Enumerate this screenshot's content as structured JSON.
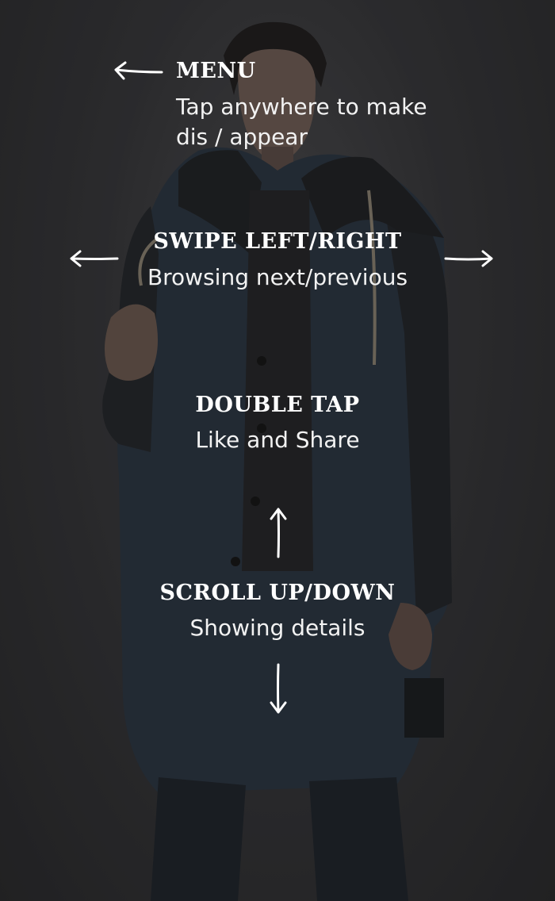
{
  "menu": {
    "title": "MENU",
    "description_line1": "Tap anywhere to make",
    "description_line2": "dis / appear"
  },
  "swipe": {
    "title": "SWIPE LEFT/RIGHT",
    "description": "Browsing next/previous"
  },
  "double_tap": {
    "title": "DOUBLE TAP",
    "description": "Like and Share"
  },
  "scroll": {
    "title": "SCROLL UP/DOWN",
    "description": "Showing details"
  },
  "colors": {
    "text": "#ffffff",
    "background": "#2b2b2d"
  }
}
